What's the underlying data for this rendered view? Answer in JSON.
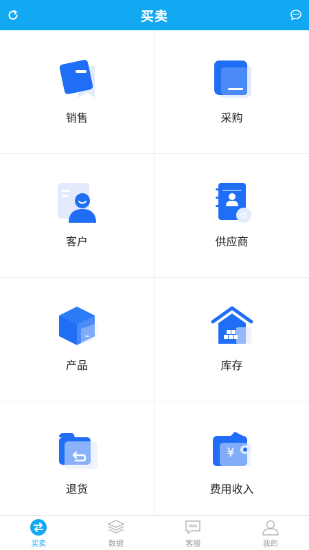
{
  "header": {
    "title": "买卖",
    "refresh_icon": "refresh-icon",
    "chat_icon": "chat-bubble-icon"
  },
  "colors": {
    "primary": "#12a9f2",
    "icon_blue": "#1f6ef5",
    "icon_light": "#e2eafc"
  },
  "grid": {
    "items": [
      {
        "label": "销售",
        "icon": "sales-icon"
      },
      {
        "label": "采购",
        "icon": "purchase-icon"
      },
      {
        "label": "客户",
        "icon": "customer-icon"
      },
      {
        "label": "供应商",
        "icon": "supplier-icon"
      },
      {
        "label": "产品",
        "icon": "product-icon"
      },
      {
        "label": "库存",
        "icon": "inventory-icon"
      },
      {
        "label": "退货",
        "icon": "returns-icon"
      },
      {
        "label": "费用收入",
        "icon": "expense-income-icon"
      }
    ]
  },
  "tabbar": {
    "tabs": [
      {
        "label": "买卖",
        "icon": "exchange-icon",
        "active": true
      },
      {
        "label": "数据",
        "icon": "layers-icon",
        "active": false
      },
      {
        "label": "客服",
        "icon": "service-chat-icon",
        "active": false
      },
      {
        "label": "我的",
        "icon": "profile-icon",
        "active": false
      }
    ]
  }
}
